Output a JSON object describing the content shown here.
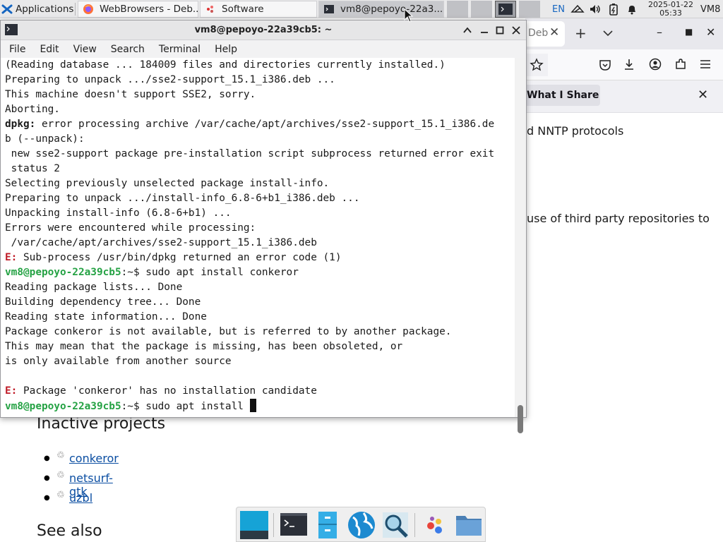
{
  "top_panel": {
    "applications_label": "Applications",
    "tasks": [
      {
        "title": "WebBrowsers - Deb...",
        "icon": "firefox-icon"
      },
      {
        "title": "Software",
        "icon": "software-icon"
      },
      {
        "title": "vm8@pepoyo-22a3...",
        "icon": "terminal-icon"
      }
    ],
    "keyboard_layout": "EN",
    "date": "2025-01-22",
    "time": "05:33",
    "user_label": "VM8"
  },
  "browser": {
    "tab_partial_label": "Deb",
    "notice_label": "What I Share",
    "text_line_1": "d NNTP protocols",
    "text_line_2": "use of third party repositories to",
    "inactive_heading": "Inactive projects",
    "inactive_links": [
      "conkeror",
      "netsurf-gtk",
      "uzbl"
    ],
    "see_also_heading": "See also"
  },
  "terminal": {
    "title": "vm8@pepoyo-22a39cb5: ~",
    "menu": [
      "File",
      "Edit",
      "View",
      "Search",
      "Terminal",
      "Help"
    ],
    "lines": [
      "(Reading database ... 184009 files and directories currently installed.)",
      "Preparing to unpack .../sse2-support_15.1_i386.deb ...",
      "This machine doesn't support SSE2, sorry.",
      "Aborting.",
      {
        "bold": "dpkg:",
        "rest": " error processing archive /var/cache/apt/archives/sse2-support_15.1_i386.de"
      },
      "b (--unpack):",
      " new sse2-support package pre-installation script subprocess returned error exit",
      " status 2",
      "Selecting previously unselected package install-info.",
      "Preparing to unpack .../install-info_6.8-6+b1_i386.deb ...",
      "Unpacking install-info (6.8-6+b1) ...",
      "Errors were encountered while processing:",
      " /var/cache/apt/archives/sse2-support_15.1_i386.deb",
      {
        "err": "E:",
        "rest": " Sub-process /usr/bin/dpkg returned an error code (1)"
      },
      {
        "prompt": "vm8@pepoyo-22a39cb5",
        "dir": ":~",
        "cmd": "$ sudo apt install conkeror"
      },
      "Reading package lists... Done",
      "Building dependency tree... Done",
      "Reading state information... Done",
      "Package conkeror is not available, but is referred to by another package.",
      "This may mean that the package is missing, has been obsoleted, or",
      "is only available from another source",
      "",
      {
        "err": "E:",
        "rest": " Package 'conkeror' has no installation candidate"
      },
      {
        "prompt": "vm8@pepoyo-22a39cb5",
        "dir": ":~",
        "cmd": "$ sudo apt install ",
        "cursor": true
      }
    ],
    "prompt_color": "#25a244",
    "error_color": "#c01c28"
  },
  "dock": {
    "items": [
      "desktop-icon",
      "terminal-icon",
      "file-cabinet-icon",
      "web-browser-icon",
      "app-finder-icon",
      "palette-icon",
      "folder-icon"
    ]
  }
}
